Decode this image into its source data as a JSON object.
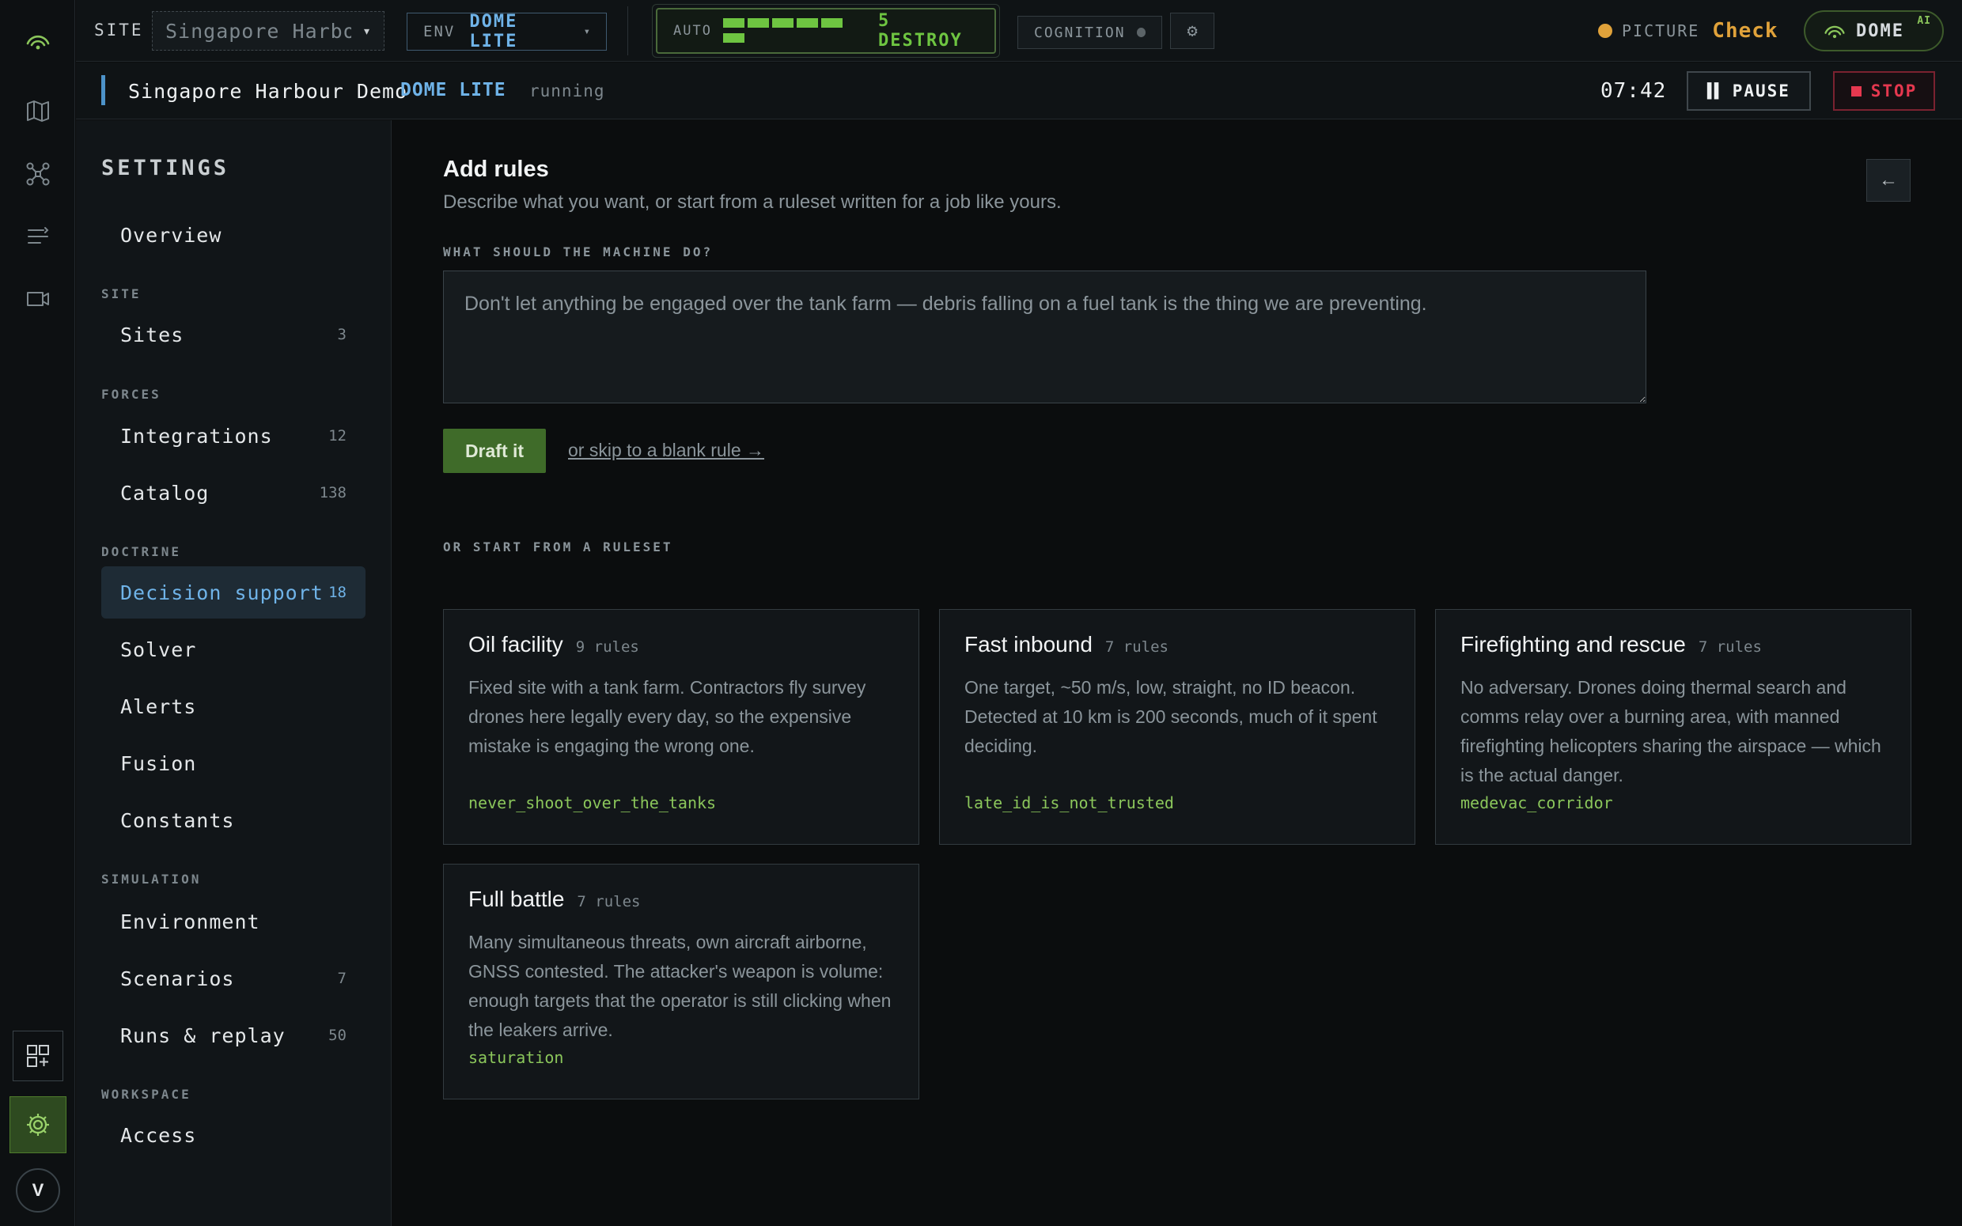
{
  "colors": {
    "accent_blue": "#6fb3e8",
    "accent_green": "#6ec541",
    "warning_amber": "#e0a23a",
    "danger_red": "#e5384f",
    "background": "#0b0d0e"
  },
  "rail": {
    "icons": [
      "radar-icon",
      "map-icon",
      "drone-icon",
      "list-icon",
      "camera-icon",
      "tiles-add-icon",
      "gear-icon"
    ],
    "avatar": "V"
  },
  "topbar": {
    "site_label": "SITE",
    "site_value": "Singapore Harbo…",
    "env_label": "ENV",
    "env_value": "DOME LITE",
    "auto_label": "AUTO",
    "auto_level_segments": 6,
    "auto_value": "5 DESTROY",
    "cognition_label": "COGNITION",
    "picture_label": "PICTURE",
    "picture_value": "Check",
    "dome_label": "DOME",
    "dome_badge": "AI"
  },
  "runbar": {
    "name": "Singapore Harbour Demo",
    "env": "DOME LITE",
    "status": "running",
    "time": "07:42",
    "pause_label": "PAUSE",
    "stop_label": "STOP"
  },
  "nav": {
    "title": "SETTINGS",
    "overview": "Overview",
    "sections": {
      "site": "SITE",
      "forces": "FORCES",
      "doctrine": "DOCTRINE",
      "simulation": "SIMULATION",
      "workspace": "WORKSPACE"
    },
    "items": {
      "sites": {
        "label": "Sites",
        "count": "3"
      },
      "integrations": {
        "label": "Integrations",
        "count": "12"
      },
      "catalog": {
        "label": "Catalog",
        "count": "138"
      },
      "decision_support": {
        "label": "Decision support",
        "count": "18"
      },
      "solver": {
        "label": "Solver"
      },
      "alerts": {
        "label": "Alerts"
      },
      "fusion": {
        "label": "Fusion"
      },
      "constants": {
        "label": "Constants"
      },
      "environment": {
        "label": "Environment"
      },
      "scenarios": {
        "label": "Scenarios",
        "count": "7"
      },
      "runs_replay": {
        "label": "Runs & replay",
        "count": "50"
      },
      "access": {
        "label": "Access"
      }
    }
  },
  "main": {
    "title": "Add rules",
    "subtitle": "Describe what you want, or start from a ruleset written for a job like yours.",
    "question_label": "WHAT SHOULD THE MACHINE DO?",
    "question_placeholder": "Don't let anything be engaged over the tank farm — debris falling on a fuel tank is the thing we are preventing.",
    "draft_label": "Draft it",
    "skip_label": "or skip to a blank rule →",
    "ruleset_label": "OR START FROM A RULESET",
    "rulesets": [
      {
        "name": "Oil facility",
        "count": "9 rules",
        "description": "Fixed site with a tank farm. Contractors fly survey drones here legally every day, so the expensive mistake is engaging the wrong one.",
        "rule": "never_shoot_over_the_tanks"
      },
      {
        "name": "Fast inbound",
        "count": "7 rules",
        "description": "One target, ~50 m/s, low, straight, no ID beacon. Detected at 10 km is 200 seconds, much of it spent deciding.",
        "rule": "late_id_is_not_trusted"
      },
      {
        "name": "Firefighting and rescue",
        "count": "7 rules",
        "description": "No adversary. Drones doing thermal search and comms relay over a burning area, with manned firefighting helicopters sharing the airspace — which is the actual danger.",
        "rule": "medevac_corridor"
      },
      {
        "name": "Full battle",
        "count": "7 rules",
        "description": "Many simultaneous threats, own aircraft airborne, GNSS contested. The attacker's weapon is volume: enough targets that the operator is still clicking when the leakers arrive.",
        "rule": "saturation"
      }
    ]
  }
}
